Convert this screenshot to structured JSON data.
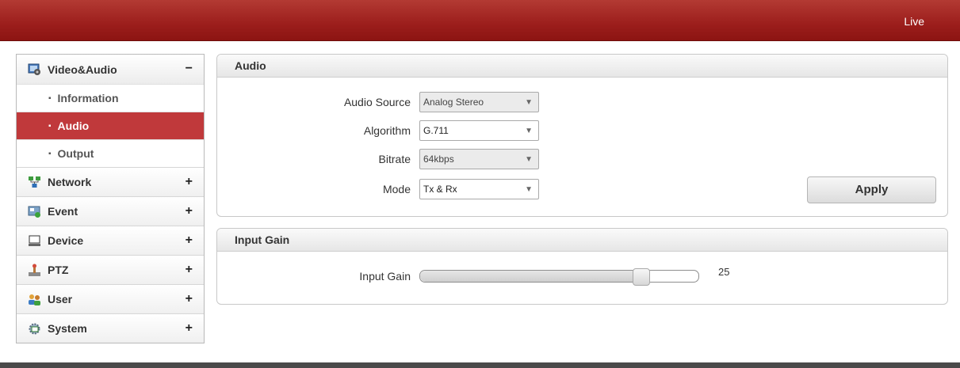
{
  "header": {
    "live_label": "Live"
  },
  "sidebar": {
    "groups": [
      {
        "label": "Video&Audio",
        "toggle": "−",
        "icon": "video-audio-icon"
      },
      {
        "label": "Network",
        "toggle": "+",
        "icon": "network-icon"
      },
      {
        "label": "Event",
        "toggle": "+",
        "icon": "event-icon"
      },
      {
        "label": "Device",
        "toggle": "+",
        "icon": "device-icon"
      },
      {
        "label": "PTZ",
        "toggle": "+",
        "icon": "ptz-icon"
      },
      {
        "label": "User",
        "toggle": "+",
        "icon": "user-icon"
      },
      {
        "label": "System",
        "toggle": "+",
        "icon": "system-icon"
      }
    ],
    "subitems": [
      {
        "label": "Information",
        "bullet": "▪"
      },
      {
        "label": "Audio",
        "bullet": "▪"
      },
      {
        "label": "Output",
        "bullet": "▪"
      }
    ],
    "active_subitem": "Audio",
    "accent_color": "#c0393b"
  },
  "audio_panel": {
    "title": "Audio",
    "audio_source": {
      "label": "Audio Source",
      "value": "Analog Stereo",
      "arrow": "▼"
    },
    "algorithm": {
      "label": "Algorithm",
      "value": "G.711",
      "arrow": "▼"
    },
    "bitrate": {
      "label": "Bitrate",
      "value": "64kbps",
      "arrow": "▼"
    },
    "mode": {
      "label": "Mode",
      "value": "Tx & Rx",
      "arrow": "▼"
    },
    "apply_label": "Apply"
  },
  "gain_panel": {
    "title": "Input Gain",
    "label": "Input Gain",
    "value": "25",
    "level_fraction": 0.81
  }
}
